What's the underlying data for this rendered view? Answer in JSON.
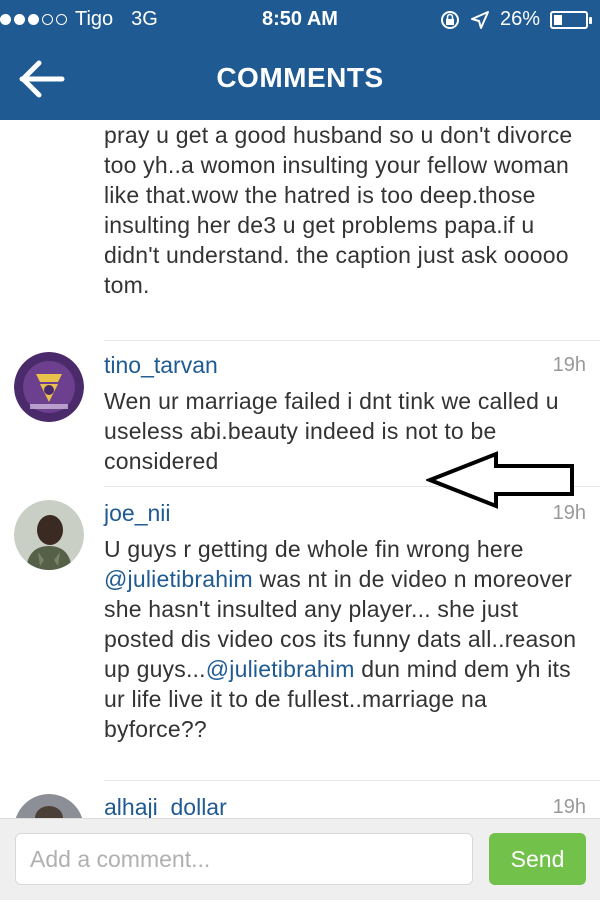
{
  "status_bar": {
    "carrier": "Tigo",
    "network": "3G",
    "time": "8:50 AM",
    "battery": "26%",
    "battery_level": 0.26,
    "signal_bars_filled": 3,
    "signal_bars_total": 5
  },
  "nav": {
    "title": "COMMENTS",
    "back_icon": "arrow-left-icon"
  },
  "comments": {
    "prev_text": "pray u get a good husband so u don't divorce too yh..a womon insulting your fellow woman like that.wow the hatred is too deep.those insulting her de3 u get problems papa.if u didn't understand. the caption just ask ooooo tom.",
    "items": [
      {
        "username": "tino_tarvan",
        "time": "19h",
        "text": "Wen ur marriage failed i dnt tink we called u useless abi.beauty indeed is not to be considered"
      },
      {
        "username": "joe_nii",
        "time": "19h",
        "text_part1": "U guys r getting de whole fin wrong here ",
        "mention1": "@julietibrahim",
        "text_part2": " was nt in de video n moreover she hasn't insulted any player... she just posted dis video cos its funny dats all..reason up guys...",
        "mention2": "@julietibrahim",
        "text_part3": " dun mind dem yh its ur life live it to de fullest..marriage na byforce??"
      },
      {
        "username": "alhaji_dollar",
        "time": "19h"
      }
    ]
  },
  "composer": {
    "placeholder": "Add a comment...",
    "send_label": "Send"
  },
  "colors": {
    "header": "#1f5a92",
    "send": "#72c14b",
    "link": "#1f5a92"
  }
}
